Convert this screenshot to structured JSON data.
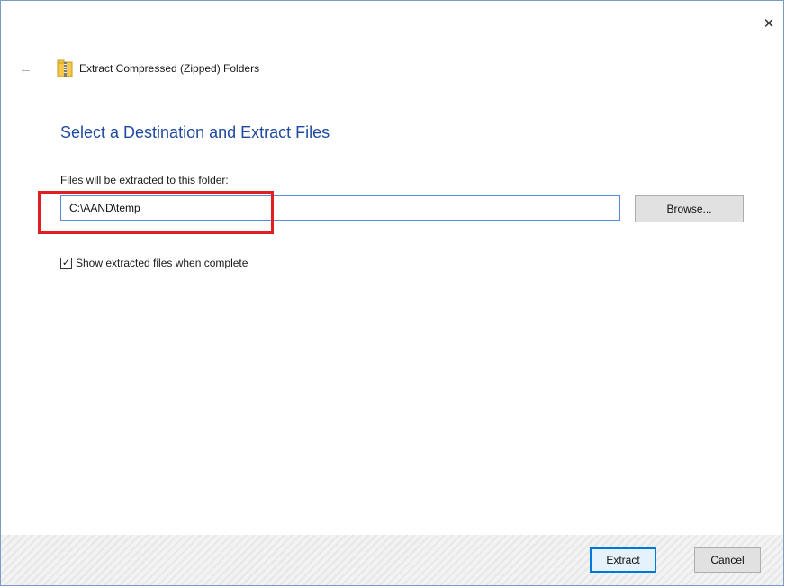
{
  "window": {
    "close_glyph": "✕",
    "title": "Extract Compressed (Zipped) Folders",
    "back_glyph": "←"
  },
  "main": {
    "heading": "Select a Destination and Extract Files",
    "field_label": "Files will be extracted to this folder:",
    "path_value": "C:\\AAND\\temp",
    "browse_label": "Browse...",
    "checkbox_checked": true,
    "checkbox_glyph": "✓",
    "checkbox_label": "Show extracted files when complete"
  },
  "footer": {
    "extract_label": "Extract",
    "cancel_label": "Cancel"
  },
  "icons": {
    "back": "back-arrow-icon",
    "folder": "zip-folder-icon",
    "close": "close-icon"
  },
  "colors": {
    "heading": "#1f4aa0",
    "highlight": "#e02020",
    "accent": "#0078d7"
  }
}
